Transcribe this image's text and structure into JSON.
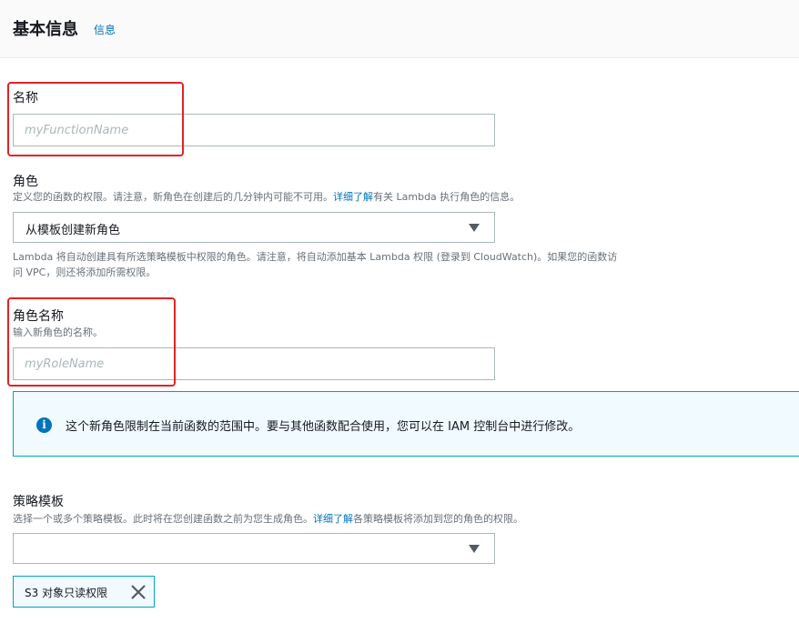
{
  "header": {
    "title": "基本信息",
    "info_link": "信息"
  },
  "function_name": {
    "label": "名称",
    "placeholder": "myFunctionName"
  },
  "role": {
    "label": "角色",
    "description_before": "定义您的函数的权限。请注意，新角色在创建后的几分钟内可能不可用。",
    "learn_more": "详细了解",
    "description_after": "有关 Lambda 执行角色的信息。",
    "selected": "从模板创建新角色",
    "note_line1": "Lambda 将自动创建具有所选策略模板中权限的角色。请注意，将自动添加基本 Lambda 权限 (登录到 CloudWatch)。如果您的函数访",
    "note_line2": "问 VPC，则还将添加所需权限。"
  },
  "role_name": {
    "label": "角色名称",
    "description": "输入新角色的名称。",
    "placeholder": "myRoleName"
  },
  "alert": {
    "icon": "info-icon",
    "text": "这个新角色限制在当前函数的范围中。要与其他函数配合使用，您可以在 IAM 控制台中进行修改。"
  },
  "policy_templates": {
    "label": "策略模板",
    "description_before": "选择一个或多个策略模板。此时将在您创建函数之前为您生成角色。",
    "learn_more": "详细了解",
    "description_after": "各策略模板将添加到您的角色的权限。",
    "selected": "",
    "tokens": [
      {
        "label": "S3 对象只读权限",
        "remove_icon": "close-icon"
      }
    ]
  },
  "colors": {
    "link": "#0073bb",
    "highlight_box": "#e02424",
    "alert_border": "#00a1c9",
    "alert_bg": "#f1faff"
  }
}
